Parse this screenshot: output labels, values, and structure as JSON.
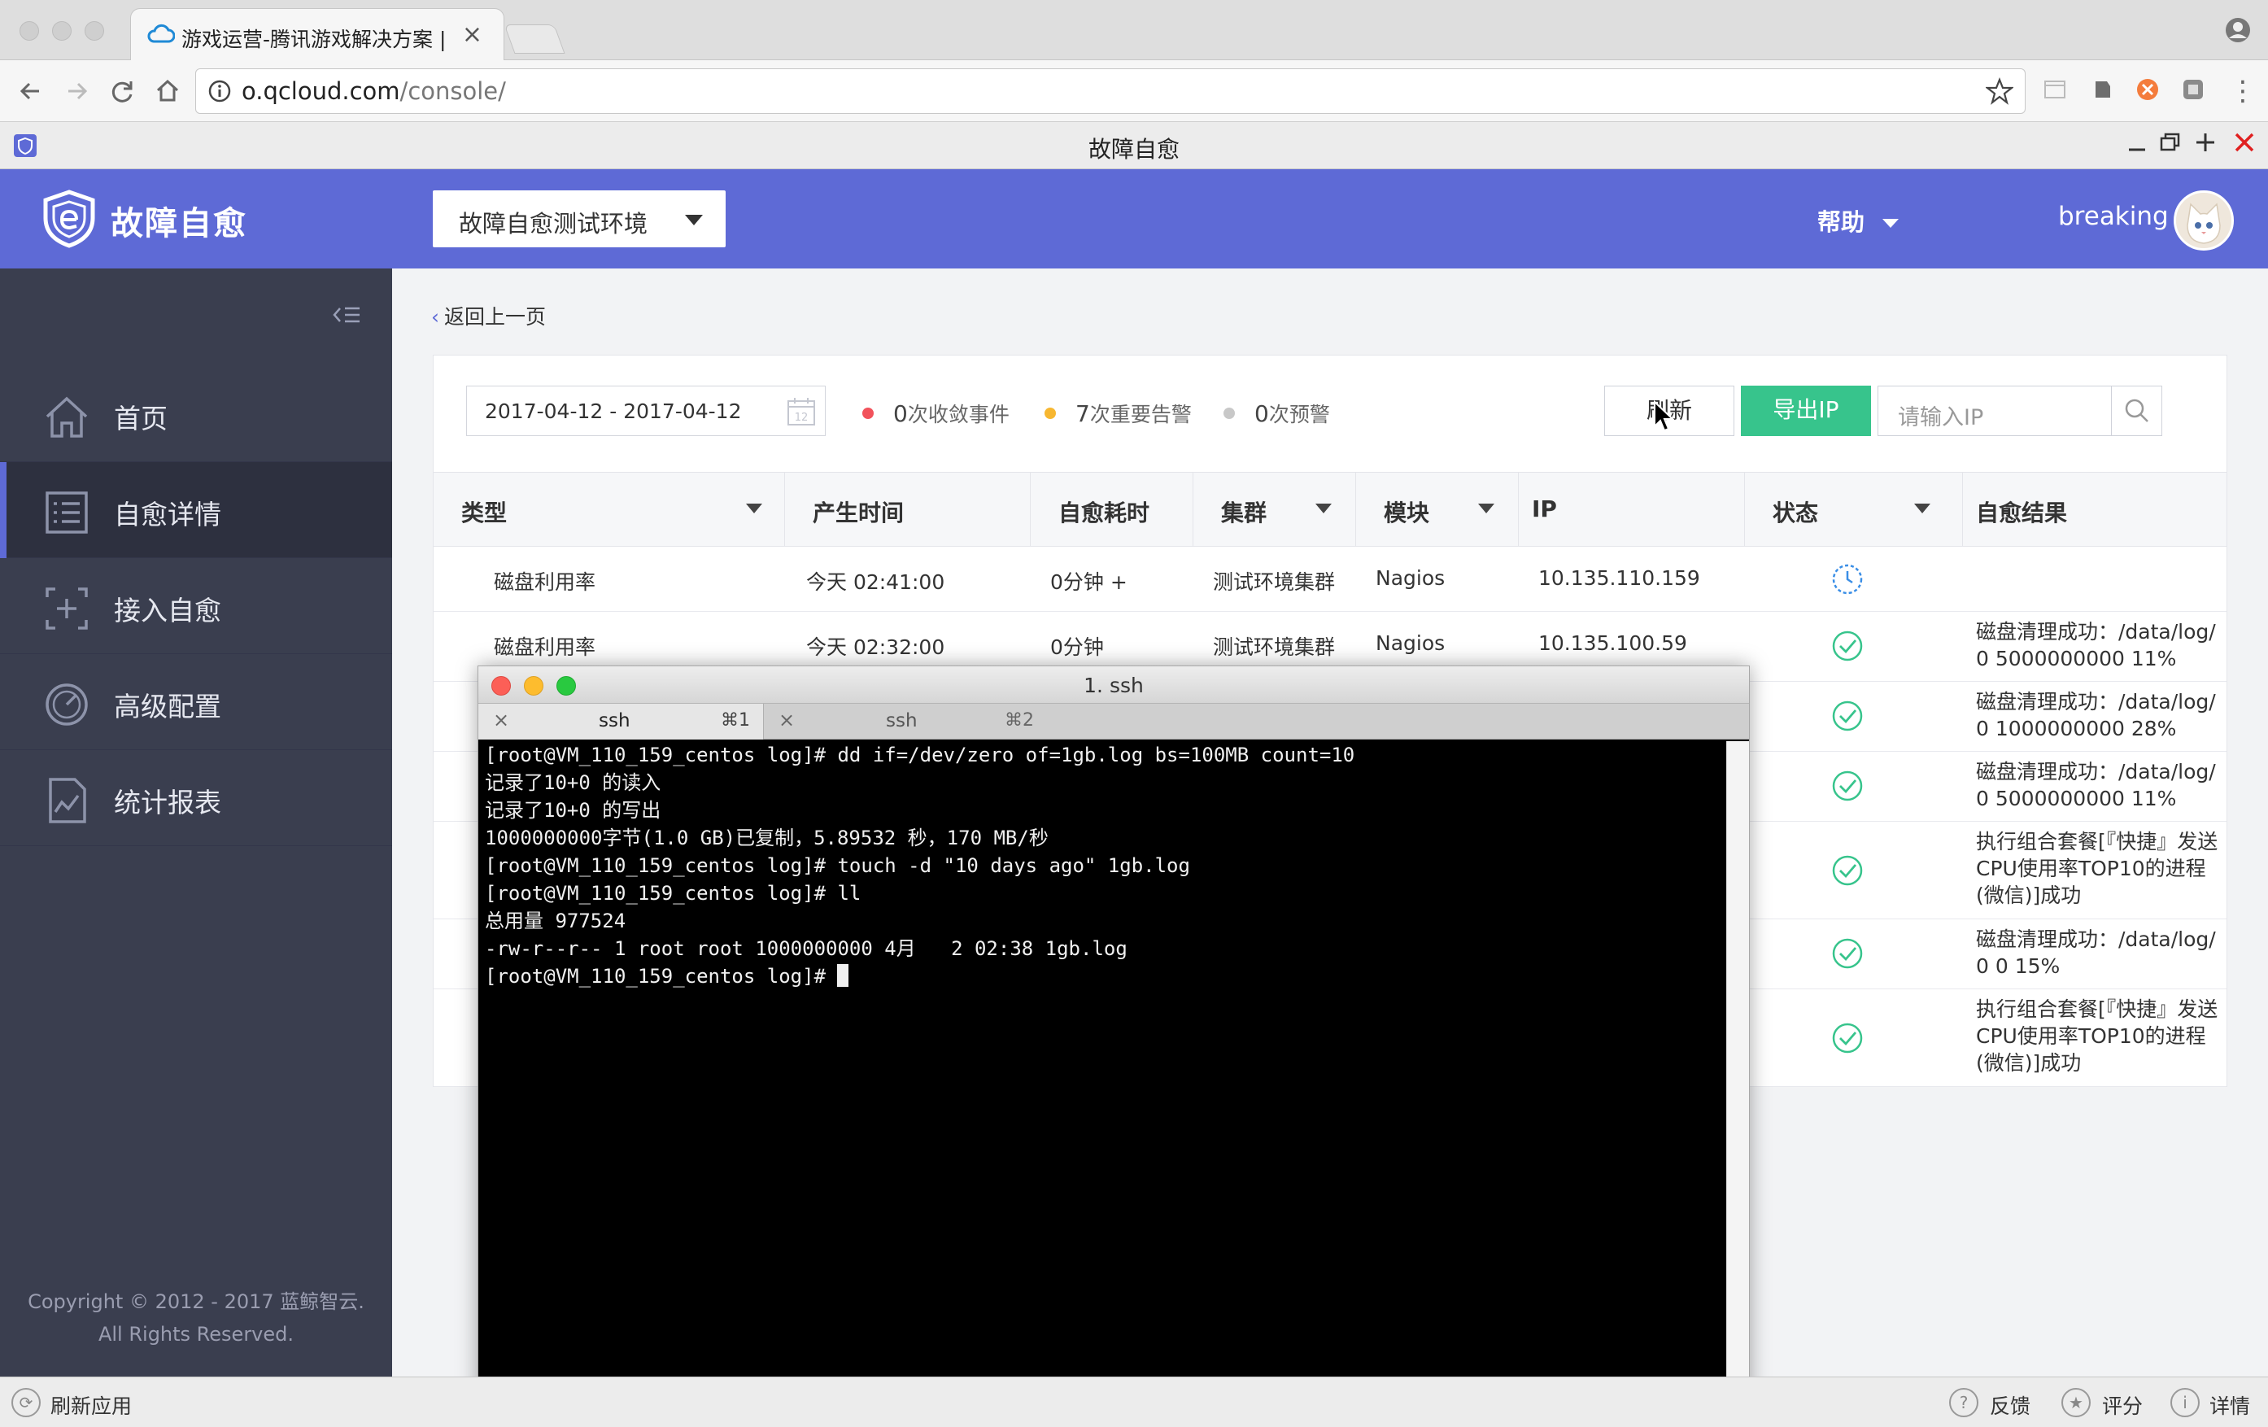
{
  "browser": {
    "tab_title": "游戏运营-腾讯游戏解决方案 | 腾",
    "tab_close": "×",
    "url_host": "o.qcloud.com",
    "url_path": "/console/"
  },
  "app_window": {
    "title": "故障自愈"
  },
  "header": {
    "logo_text": "故障自愈",
    "env_selected": "故障自愈测试环境",
    "help_label": "帮助",
    "username": "breaking"
  },
  "sidebar": {
    "items": [
      {
        "label": "首页",
        "icon": "home-icon"
      },
      {
        "label": "自愈详情",
        "icon": "list-icon",
        "active": true
      },
      {
        "label": "接入自愈",
        "icon": "plus-box-icon"
      },
      {
        "label": "高级配置",
        "icon": "gauge-icon"
      },
      {
        "label": "统计报表",
        "icon": "chart-icon"
      }
    ],
    "copyright_line1": "Copyright © 2012 - 2017 蓝鲸智云.",
    "copyright_line2": "All Rights Reserved."
  },
  "main": {
    "back_label": "返回上一页",
    "date_range": "2017-04-12 - 2017-04-12",
    "stats": [
      {
        "count": "0",
        "label": "次收敛事件",
        "color": "#f2525b"
      },
      {
        "count": "7",
        "label": "次重要告警",
        "color": "#f7b731"
      },
      {
        "count": "0",
        "label": "次预警",
        "color": "#c8c8c8"
      }
    ],
    "refresh_label": "刷新",
    "export_label": "导出IP",
    "ip_placeholder": "请输入IP"
  },
  "table": {
    "columns": [
      "类型",
      "产生时间",
      "自愈耗时",
      "集群",
      "模块",
      "IP",
      "状态",
      "自愈结果"
    ],
    "rows": [
      {
        "type": "磁盘利用率",
        "time": "今天 02:41:00",
        "duration": "0分钟 +",
        "cluster": "测试环境集群",
        "module": "Nagios",
        "ip": "10.135.110.159",
        "status": "in-progress",
        "result": ""
      },
      {
        "type": "磁盘利用率",
        "time": "今天 02:32:00",
        "duration": "0分钟",
        "cluster": "测试环境集群",
        "module": "Nagios",
        "ip": "10.135.100.59",
        "status": "success",
        "result": "磁盘清理成功：/data/log/ 0 5000000000 11%"
      },
      {
        "status": "success",
        "result": "磁盘清理成功：/data/log/ 0 1000000000 28%"
      },
      {
        "status": "success",
        "result": "磁盘清理成功：/data/log/ 0 5000000000 11%"
      },
      {
        "status": "success",
        "result": "执行组合套餐[『快捷』发送CPU使用率TOP10的进程(微信)]成功"
      },
      {
        "status": "success",
        "result": "磁盘清理成功：/data/log/ 0 0 15%"
      },
      {
        "status": "success",
        "result": "执行组合套餐[『快捷』发送CPU使用率TOP10的进程(微信)]成功"
      }
    ]
  },
  "terminal": {
    "title": "1. ssh",
    "tabs": [
      {
        "name": "ssh",
        "shortcut": "⌘1"
      },
      {
        "name": "ssh",
        "shortcut": "⌘2"
      }
    ],
    "lines": [
      "[root@VM_110_159_centos log]# dd if=/dev/zero of=1gb.log bs=100MB count=10",
      "记录了10+0 的读入",
      "记录了10+0 的写出",
      "1000000000字节(1.0 GB)已复制，5.89532 秒，170 MB/秒",
      "[root@VM_110_159_centos log]# touch -d \"10 days ago\" 1gb.log",
      "[root@VM_110_159_centos log]# ll",
      "总用量 977524",
      "-rw-r--r-- 1 root root 1000000000 4月   2 02:38 1gb.log",
      "[root@VM_110_159_centos log]# "
    ]
  },
  "statusbar": {
    "refresh_app": "刷新应用",
    "feedback": "反馈",
    "rate": "评分",
    "details": "详情"
  }
}
